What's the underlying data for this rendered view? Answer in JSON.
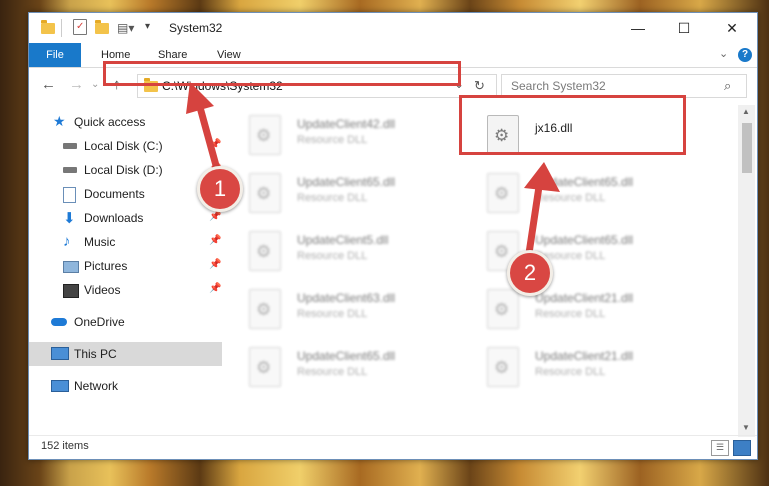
{
  "window": {
    "title": "System32"
  },
  "ribbon": {
    "file": "File",
    "tabs": [
      "Home",
      "Share",
      "View"
    ],
    "help_icon": "?"
  },
  "navigation": {
    "back_icon": "arrow-left-icon",
    "forward_icon": "arrow-right-icon",
    "up_icon": "arrow-up-icon",
    "address": "C:\\Windows\\System32",
    "search_placeholder": "Search System32"
  },
  "sidebar": {
    "items": [
      {
        "label": "Quick access",
        "icon": "star-icon",
        "pinned": false
      },
      {
        "label": "Local Disk (C:)",
        "icon": "drive-icon",
        "pinned": true
      },
      {
        "label": "Local Disk (D:)",
        "icon": "drive-icon",
        "pinned": true
      },
      {
        "label": "Documents",
        "icon": "documents-icon",
        "pinned": true
      },
      {
        "label": "Downloads",
        "icon": "download-icon",
        "pinned": true
      },
      {
        "label": "Music",
        "icon": "music-icon",
        "pinned": true
      },
      {
        "label": "Pictures",
        "icon": "pictures-icon",
        "pinned": true
      },
      {
        "label": "Videos",
        "icon": "videos-icon",
        "pinned": true
      },
      {
        "label": "OneDrive",
        "icon": "cloud-icon",
        "pinned": false
      },
      {
        "label": "This PC",
        "icon": "computer-icon",
        "pinned": false,
        "selected": true
      },
      {
        "label": "Network",
        "icon": "network-icon",
        "pinned": false
      }
    ]
  },
  "files": {
    "highlighted": {
      "name": "jx16.dll",
      "type": ""
    },
    "left_column": [
      {
        "name": "UpdateClient42.dll",
        "type": "Resource DLL"
      },
      {
        "name": "UpdateClient65.dll",
        "type": "Resource DLL"
      },
      {
        "name": "UpdateClient5.dll",
        "type": "Resource DLL"
      },
      {
        "name": "UpdateClient63.dll",
        "type": "Resource DLL"
      },
      {
        "name": "UpdateClient65.dll",
        "type": "Resource DLL"
      }
    ],
    "right_column": [
      {
        "name": "UpdateClient65.dll",
        "type": "Resource DLL"
      },
      {
        "name": "UpdateClient65.dll",
        "type": "Resource DLL"
      },
      {
        "name": "UpdateClient21.dll",
        "type": "Resource DLL"
      },
      {
        "name": "UpdateClient21.dll",
        "type": "Resource DLL"
      }
    ]
  },
  "status": {
    "item_count": "152 items"
  },
  "annotations": {
    "step1": "1",
    "step2": "2",
    "color": "#d6433f"
  }
}
